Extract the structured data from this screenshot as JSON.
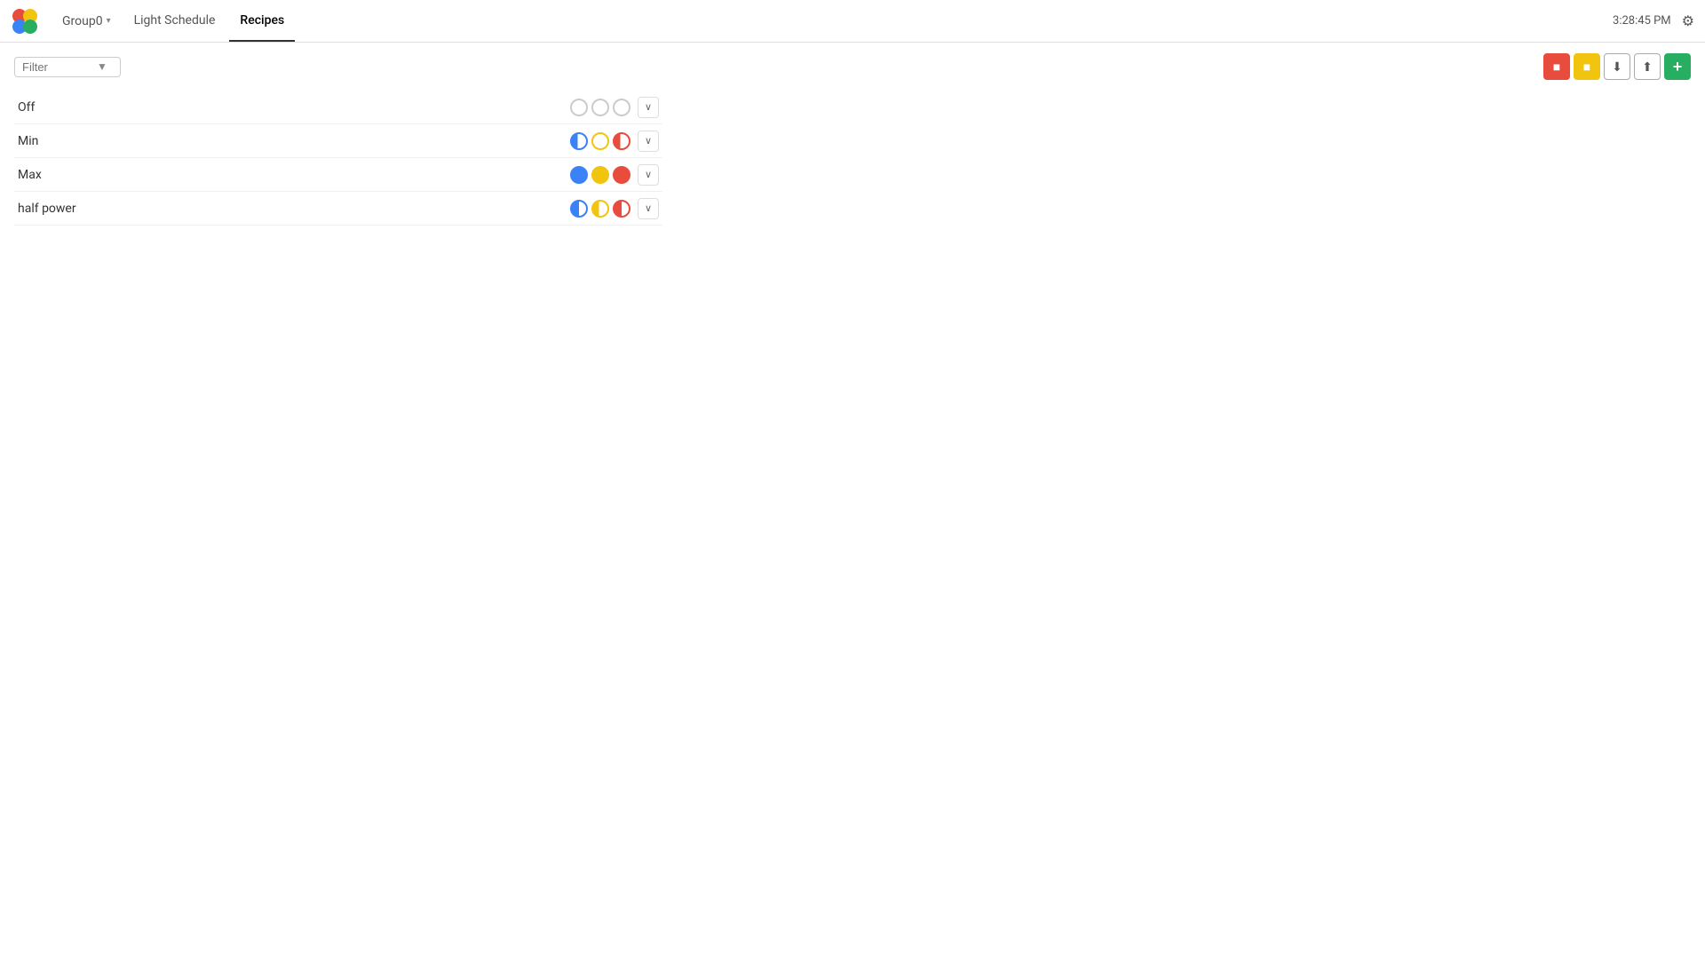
{
  "app": {
    "logo_label": "App Logo"
  },
  "navbar": {
    "group_label": "Group0",
    "group_chevron": "▾",
    "tabs": [
      {
        "id": "light-schedule",
        "label": "Light Schedule",
        "active": false
      },
      {
        "id": "recipes",
        "label": "Recipes",
        "active": true
      }
    ],
    "time": "3:28:45 PM",
    "settings_icon": "⚙"
  },
  "toolbar": {
    "filter_placeholder": "Filter",
    "filter_icon": "▼",
    "btn_red_label": "■",
    "btn_yellow_label": "■",
    "btn_import_label": "↓",
    "btn_export_label": "↑",
    "btn_add_label": "+"
  },
  "recipes": [
    {
      "id": "off",
      "name": "Off",
      "circles": [
        "empty",
        "empty",
        "empty"
      ],
      "expand": "∨"
    },
    {
      "id": "min",
      "name": "Min",
      "circles": [
        "blue-quarter",
        "empty",
        "red-quarter"
      ],
      "expand": "∨"
    },
    {
      "id": "max",
      "name": "Max",
      "circles": [
        "blue-full",
        "yellow-full",
        "red-full"
      ],
      "expand": "∨"
    },
    {
      "id": "half-power",
      "name": "half power",
      "circles": [
        "blue-half",
        "yellow-half",
        "red-half"
      ],
      "expand": "∨"
    }
  ]
}
